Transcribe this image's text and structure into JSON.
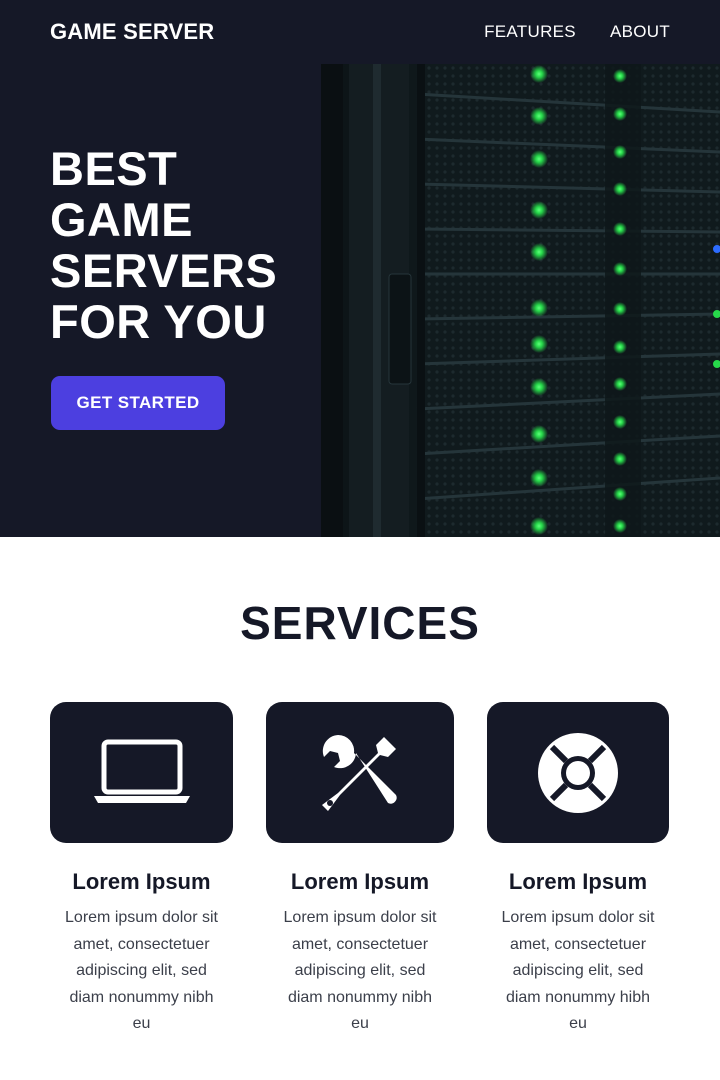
{
  "header": {
    "brand": "GAME SERVER",
    "nav": [
      {
        "label": "FEATURES"
      },
      {
        "label": "ABOUT"
      }
    ]
  },
  "hero": {
    "headline": [
      "BEST",
      "GAME",
      "SERVERS",
      "FOR YOU"
    ],
    "cta_label": "GET STARTED",
    "image": "server-rack-photo"
  },
  "colors": {
    "background_dark": "#151827",
    "accent": "#4c3fe0",
    "led_green": "#27d84a"
  },
  "services": {
    "title": "SERVICES",
    "cards": [
      {
        "icon": "laptop-icon",
        "title": "Lorem Ipsum",
        "text": "Lorem ipsum dolor sit amet, consectetuer adipiscing elit, sed diam nonummy nibh eu"
      },
      {
        "icon": "tools-icon",
        "title": "Lorem Ipsum",
        "text": "Lorem ipsum dolor sit amet, consectetuer adipiscing elit, sed diam nonummy nibh eu"
      },
      {
        "icon": "lifebuoy-icon",
        "title": "Lorem Ipsum",
        "text": "Lorem ipsum dolor sit amet, consectetuer adipiscing elit, sed diam nonummy hibh eu"
      }
    ]
  }
}
